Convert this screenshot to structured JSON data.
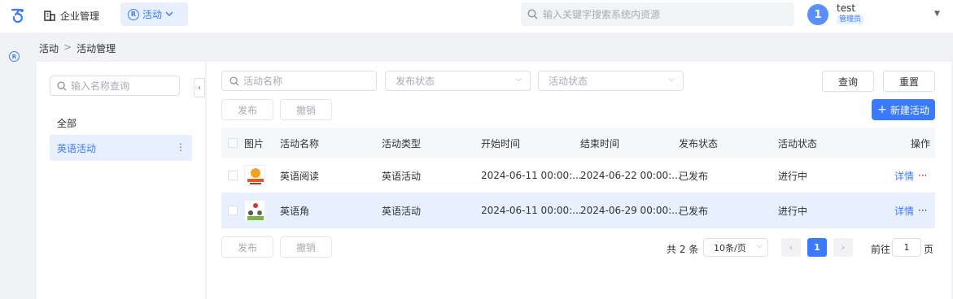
{
  "header": {
    "nav_enterprise": "企业管理",
    "nav_activity": "活动",
    "search_placeholder": "输入关键字搜索系统内资源",
    "avatar_text": "1",
    "user_name": "test",
    "user_role": "管理员"
  },
  "breadcrumb": {
    "root": "活动",
    "current": "活动管理"
  },
  "tree": {
    "search_placeholder": "输入名称查询",
    "all_label": "全部",
    "selected_label": "英语活动"
  },
  "filters": {
    "name_placeholder": "活动名称",
    "publish_status_placeholder": "发布状态",
    "activity_status_placeholder": "活动状态",
    "query_label": "查询",
    "reset_label": "重置"
  },
  "actions": {
    "publish_label": "发布",
    "revoke_label": "撤销",
    "new_label": "新建活动"
  },
  "table": {
    "columns": [
      "图片",
      "活动名称",
      "活动类型",
      "开始时间",
      "结束时间",
      "发布状态",
      "活动状态",
      "操作"
    ],
    "rows": [
      {
        "name": "英语阅读",
        "type": "英语活动",
        "start": "2024-06-11 00:00:...",
        "end": "2024-06-22 00:00:...",
        "publish_status": "已发布",
        "activity_status": "进行中",
        "detail": "详情",
        "more": "···"
      },
      {
        "name": "英语角",
        "type": "英语活动",
        "start": "2024-06-11 00:00:...",
        "end": "2024-06-29 00:00:...",
        "publish_status": "已发布",
        "activity_status": "进行中",
        "detail": "详情",
        "more": "···"
      }
    ]
  },
  "pagination": {
    "total": "共 2 条",
    "page_size": "10条/页",
    "current_page": "1",
    "goto_label": "前往",
    "goto_value": "1",
    "goto_suffix": "页"
  },
  "colors": {
    "primary": "#3a7afe",
    "selected_bg": "#e8f0ff"
  }
}
